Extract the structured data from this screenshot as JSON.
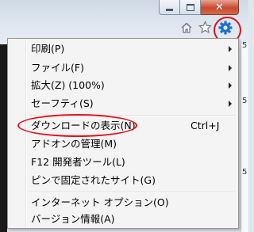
{
  "caption_buttons": {
    "minimize": "minimize-icon",
    "maximize": "maximize-icon",
    "close_glyph": "✕"
  },
  "toolbar": {
    "home_icon": "home-icon",
    "favorites_icon": "star-icon",
    "tools_icon": "gear-icon"
  },
  "edge_text": {
    "right_digits": [
      "5",
      "5",
      "5"
    ]
  },
  "menu": {
    "items": [
      {
        "label": "印刷(P)",
        "has_submenu": true
      },
      {
        "label": "ファイル(F)",
        "has_submenu": true
      },
      {
        "label": "拡大(Z) (100%)",
        "has_submenu": true
      },
      {
        "label": "セーフティ(S)",
        "has_submenu": true
      },
      {
        "label": "ダウンロードの表示(N)",
        "shortcut": "Ctrl+J"
      },
      {
        "label": "アドオンの管理(M)"
      },
      {
        "label": "F12 開発者ツール(L)"
      },
      {
        "label": "ピンで固定されたサイト(G)"
      },
      {
        "label": "インターネット オプション(O)"
      },
      {
        "label": "バージョン情報(A)"
      }
    ]
  },
  "colors": {
    "annotation_red": "#e0101a",
    "gear_blue": "#1f6fd1",
    "close_red": "#c8482f"
  }
}
